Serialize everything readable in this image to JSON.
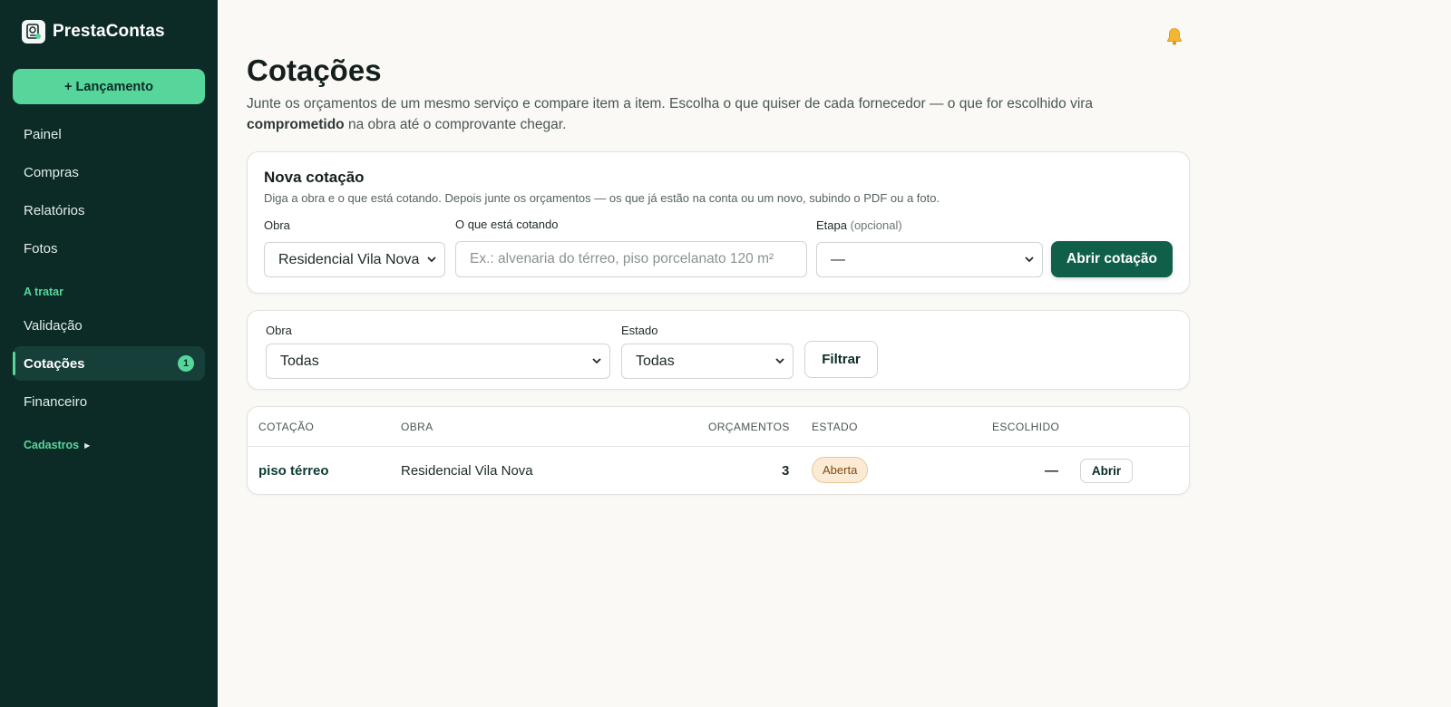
{
  "app": {
    "name": "PrestaContas"
  },
  "sidebar": {
    "new_button": "+ Lançamento",
    "items": [
      {
        "label": "Painel"
      },
      {
        "label": "Compras"
      },
      {
        "label": "Relatórios"
      },
      {
        "label": "Fotos"
      }
    ],
    "section_label": "A tratar",
    "tratar_items": [
      {
        "label": "Validação"
      },
      {
        "label": "Cotações",
        "badge": "1",
        "active": true
      },
      {
        "label": "Financeiro"
      }
    ],
    "cadastros_label": "Cadastros"
  },
  "page": {
    "title": "Cotações",
    "desc_part1": "Junte os orçamentos de um mesmo serviço e compare item a item. Escolha o que quiser de cada fornecedor — o que for escolhido vira ",
    "desc_strong": "comprometido",
    "desc_part2": " na obra até o comprovante chegar."
  },
  "new_quote": {
    "title": "Nova cotação",
    "subtitle": "Diga a obra e o que está cotando. Depois junte os orçamentos — os que já estão na conta ou um novo, subindo o PDF ou a foto.",
    "obra_label": "Obra",
    "obra_value": "Residencial Vila Nova",
    "item_label": "O que está cotando",
    "item_placeholder": "Ex.: alvenaria do térreo, piso porcelanato 120 m²",
    "etapa_label": "Etapa",
    "etapa_optional": "(opcional)",
    "etapa_value": "—",
    "submit_label": "Abrir cotação"
  },
  "filter": {
    "obra_label": "Obra",
    "obra_value": "Todas",
    "estado_label": "Estado",
    "estado_value": "Todas",
    "button_label": "Filtrar"
  },
  "table": {
    "columns": [
      "COTAÇÃO",
      "OBRA",
      "ORÇAMENTOS",
      "ESTADO",
      "ESCOLHIDO"
    ],
    "rows": [
      {
        "cotacao": "piso térreo",
        "obra": "Residencial Vila Nova",
        "orcamentos": "3",
        "estado": "Aberta",
        "escolhido": "—",
        "action": "Abrir"
      }
    ]
  },
  "colors": {
    "sidebar_bg": "#0c2b27",
    "accent": "#57d69b",
    "primary": "#0f5f4a",
    "status_open_bg": "#fcebd4"
  },
  "icons": {
    "bell": "bell-icon",
    "logo": "logo-icon",
    "caret": "caret-right-icon",
    "select": "chevron-down-icon"
  }
}
